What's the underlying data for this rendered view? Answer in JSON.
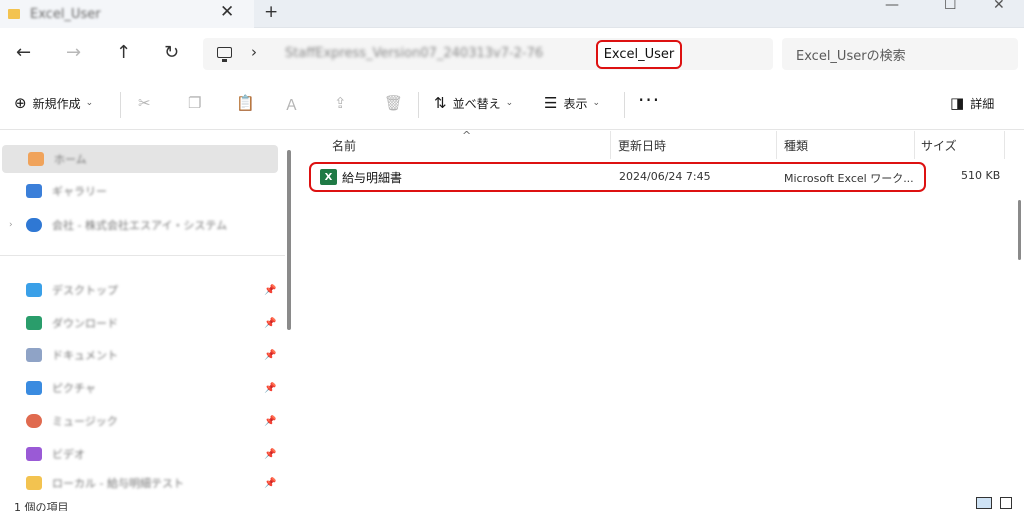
{
  "tabbar": {
    "tab_title": "Excel_User",
    "close_glyph": "✕",
    "new_tab_glyph": "+"
  },
  "window": {
    "minimize_glyph": "—",
    "maximize_glyph": "☐",
    "close_glyph": "✕"
  },
  "nav": {
    "back": "←",
    "forward": "→",
    "up": "↑",
    "refresh": "↻"
  },
  "address": {
    "chevron": "›",
    "blurred_path": "StaffExpress_Version07_240313v7-2-76",
    "current_folder": "Excel_User"
  },
  "search": {
    "placeholder": "Excel_Userの検索"
  },
  "commandbar": {
    "new_label": "新規作成",
    "sort_label": "並べ替え",
    "view_label": "表示",
    "details_label": "詳細",
    "more_glyph": "···"
  },
  "sidebar": {
    "items": [
      {
        "label": "ホーム",
        "icon": "home-icon",
        "color": "#f0a35b",
        "selected": true
      },
      {
        "label": "ギャラリー",
        "icon": "gallery-icon",
        "color": "#3b7fd9"
      },
      {
        "label": "会社 - 株式会社エスアイ・システム",
        "icon": "onedrive-icon",
        "color": "#2f78d4",
        "expander": "›"
      },
      {
        "label": "デスクトップ",
        "icon": "desktop-icon",
        "color": "#3aa0e8",
        "pinned": true
      },
      {
        "label": "ダウンロード",
        "icon": "download-icon",
        "color": "#2a9d6b",
        "pinned": true
      },
      {
        "label": "ドキュメント",
        "icon": "documents-icon",
        "color": "#8fa3c6",
        "pinned": true
      },
      {
        "label": "ピクチャ",
        "icon": "pictures-icon",
        "color": "#3a8be0",
        "pinned": true
      },
      {
        "label": "ミュージック",
        "icon": "music-icon",
        "color": "#e06a4f",
        "pinned": true
      },
      {
        "label": "ビデオ",
        "icon": "videos-icon",
        "color": "#9a5ad6",
        "pinned": true
      },
      {
        "label": "ローカル - 給与明細テスト",
        "icon": "folder-icon",
        "color": "#f3c350",
        "pinned": true
      }
    ]
  },
  "columns": {
    "name": "名前",
    "date": "更新日時",
    "type": "種類",
    "size": "サイズ"
  },
  "files": [
    {
      "name": "給与明細書",
      "date": "2024/06/24 7:45",
      "type": "Microsoft Excel ワーク...",
      "size": "510 KB",
      "icon": "excel-icon",
      "icon_color": "#1f7a45"
    }
  ],
  "status": {
    "count": "1 個の項目"
  },
  "accent": {
    "highlight_border": "#dd1111"
  }
}
